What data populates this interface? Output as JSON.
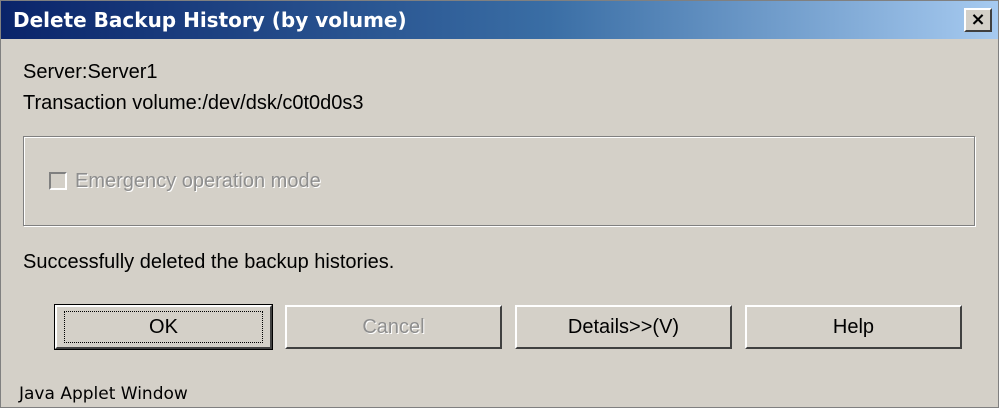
{
  "window": {
    "title": "Delete Backup History (by volume)",
    "close_label": "×"
  },
  "info": {
    "server": "Server:Server1",
    "volume": "Transaction volume:/dev/dsk/c0t0d0s3"
  },
  "options": {
    "emergency_mode": {
      "label": "Emergency operation mode",
      "checked": false,
      "enabled": false
    }
  },
  "status_message": "Successfully deleted the backup histories.",
  "buttons": {
    "ok": "OK",
    "cancel": "Cancel",
    "details": "Details>>(V)",
    "help": "Help"
  },
  "footer": "Java Applet Window",
  "colors": {
    "titlebar_start": "#0a246a",
    "titlebar_end": "#a6caf0",
    "face": "#d4d0c8",
    "disabled_text": "#8e8e8e"
  }
}
